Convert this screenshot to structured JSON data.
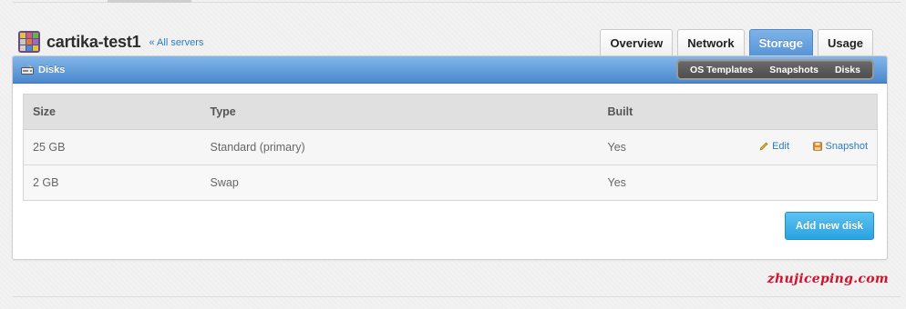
{
  "server": {
    "name": "cartika-test1",
    "back_link": "« All servers"
  },
  "tabs": [
    {
      "label": "Overview",
      "active": false
    },
    {
      "label": "Network",
      "active": false
    },
    {
      "label": "Storage",
      "active": true
    },
    {
      "label": "Usage",
      "active": false
    }
  ],
  "panel": {
    "title": "Disks",
    "subnav": [
      "OS Templates",
      "Snapshots",
      "Disks"
    ]
  },
  "table": {
    "headers": [
      "Size",
      "Type",
      "Built",
      ""
    ],
    "rows": [
      {
        "size": "25 GB",
        "type": "Standard (primary)",
        "built": "Yes",
        "actions": [
          "Edit",
          "Snapshot"
        ]
      },
      {
        "size": "2 GB",
        "type": "Swap",
        "built": "Yes",
        "actions": []
      }
    ]
  },
  "add_button": "Add new disk",
  "watermark": "zhujiceping.com",
  "colors": {
    "accent_blue": "#5795d8",
    "link_blue": "#2b7bc1",
    "button_blue": "#2aa3df",
    "watermark_red": "#d0132c"
  }
}
